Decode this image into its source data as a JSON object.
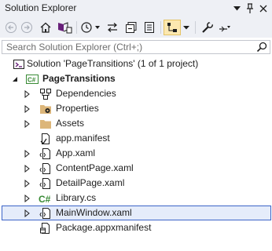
{
  "window": {
    "title": "Solution Explorer",
    "dropdown_icon": "chevron-down-icon",
    "pin_icon": "pin-icon",
    "close_icon": "close-icon"
  },
  "toolbar": {
    "buttons": [
      {
        "name": "back",
        "icon": "back-arrow-icon"
      },
      {
        "name": "forward",
        "icon": "forward-arrow-icon"
      },
      {
        "name": "home",
        "icon": "home-icon"
      },
      {
        "name": "switch-views",
        "icon": "switch-views-icon"
      },
      {
        "name": "pending-changes-filter",
        "icon": "history-clock-icon"
      },
      {
        "name": "sync-with-document",
        "icon": "sync-arrows-icon"
      },
      {
        "name": "collapse-all",
        "icon": "collapse-all-icon"
      },
      {
        "name": "show-all-files",
        "icon": "show-all-files-icon"
      },
      {
        "name": "preview-selected",
        "icon": "preview-icon",
        "active": true
      },
      {
        "name": "properties",
        "icon": "wrench-icon"
      },
      {
        "name": "toolbar-options",
        "icon": "options-icon"
      }
    ]
  },
  "search": {
    "placeholder": "Search Solution Explorer (Ctrl+;)",
    "icon": "search-icon"
  },
  "tree": {
    "solution_label": "Solution 'PageTransitions' (1 of 1 project)",
    "project_label": "PageTransitions",
    "items": [
      {
        "label": "Dependencies",
        "icon": "dependencies-icon",
        "expandable": true
      },
      {
        "label": "Properties",
        "icon": "properties-folder-icon",
        "expandable": true
      },
      {
        "label": "Assets",
        "icon": "folder-icon",
        "expandable": true
      },
      {
        "label": "app.manifest",
        "icon": "manifest-file-icon",
        "expandable": false
      },
      {
        "label": "App.xaml",
        "icon": "xaml-file-icon",
        "expandable": true
      },
      {
        "label": "ContentPage.xaml",
        "icon": "xaml-file-icon",
        "expandable": true
      },
      {
        "label": "DetailPage.xaml",
        "icon": "xaml-file-icon",
        "expandable": true
      },
      {
        "label": "Library.cs",
        "icon": "csharp-file-icon",
        "expandable": true
      },
      {
        "label": "MainWindow.xaml",
        "icon": "xaml-file-icon",
        "expandable": true,
        "selected": true
      },
      {
        "label": "Package.appxmanifest",
        "icon": "appx-manifest-icon",
        "expandable": false
      }
    ]
  },
  "colors": {
    "chrome_bg": "#eef0f5",
    "selection_bg": "#e5ecfa",
    "selection_border": "#3c64c8",
    "active_button_bg": "#fce8b0",
    "folder": "#dcb67a",
    "csharp": "#388a34"
  }
}
